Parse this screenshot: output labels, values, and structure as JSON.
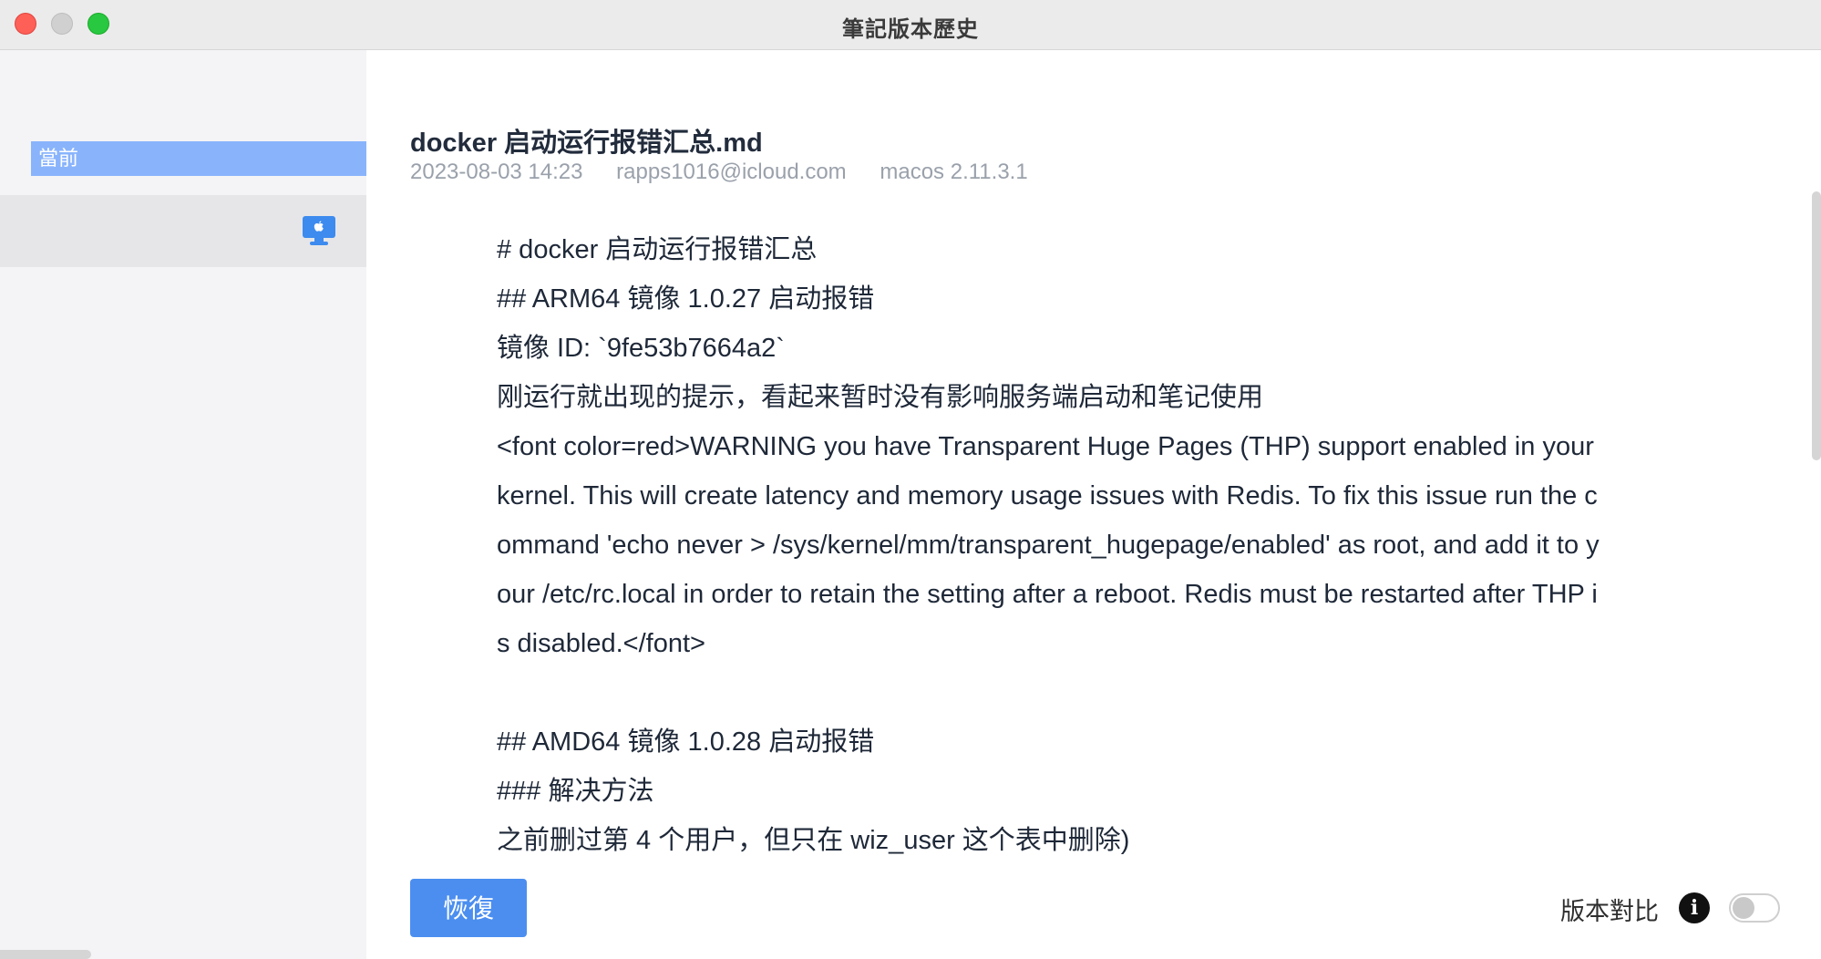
{
  "window": {
    "title": "筆記版本歷史"
  },
  "sidebar": {
    "current_label": "當前",
    "version_icon": "desktop-apple-icon"
  },
  "note": {
    "title": "docker 启动运行报错汇总.md",
    "date": "2023-08-03 14:23",
    "author": "rapps1016@icloud.com",
    "client": "macos 2.11.3.1",
    "lines": [
      "# docker 启动运行报错汇总",
      "## ARM64 镜像 1.0.27 启动报错",
      "镜像 ID: `9fe53b7664a2`",
      "刚运行就出现的提示，看起来暂时没有影响服务端启动和笔记使用",
      "<font color=red>WARNING you have Transparent Huge Pages (THP) support enabled in your",
      "kernel. This will create latency and memory usage issues with Redis. To fix this issue run the c",
      "ommand 'echo never > /sys/kernel/mm/transparent_hugepage/enabled' as root, and add it to y",
      "our /etc/rc.local in order to retain the setting after a reboot. Redis must be restarted after THP i",
      "s disabled.</font>",
      "",
      "## AMD64 镜像 1.0.28 启动报错",
      "### 解决方法",
      "之前删过第 4 个用户，但只在 wiz_user 这个表中删除)"
    ]
  },
  "footer": {
    "restore_label": "恢復",
    "compare_label": "版本對比",
    "compare_enabled": false,
    "info_icon": "info-icon"
  }
}
